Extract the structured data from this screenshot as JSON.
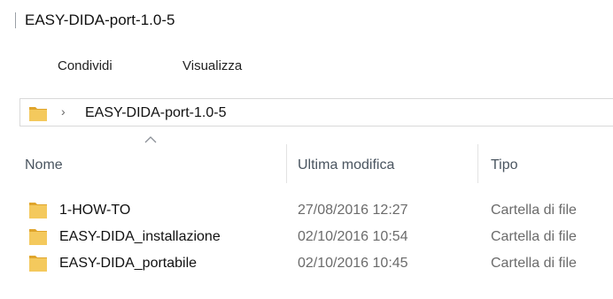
{
  "window": {
    "title": "EASY-DIDA-port-1.0-5"
  },
  "ribbon": {
    "tabs": [
      {
        "label": "Condividi"
      },
      {
        "label": "Visualizza"
      }
    ]
  },
  "address": {
    "path": "EASY-DIDA-port-1.0-5",
    "chevron": "›"
  },
  "columns": [
    {
      "label": "Nome"
    },
    {
      "label": "Ultima modifica"
    },
    {
      "label": "Tipo"
    }
  ],
  "files": [
    {
      "name": "1-HOW-TO",
      "modified": "27/08/2016 12:27",
      "type": "Cartella di file"
    },
    {
      "name": "EASY-DIDA_installazione",
      "modified": "02/10/2016 10:54",
      "type": "Cartella di file"
    },
    {
      "name": "EASY-DIDA_portabile",
      "modified": "02/10/2016 10:45",
      "type": "Cartella di file"
    }
  ],
  "colors": {
    "folder_body": "#f4c95d",
    "folder_back": "#e0a52c",
    "header_text": "#4a5560",
    "secondary_text": "#6b6b6b"
  }
}
